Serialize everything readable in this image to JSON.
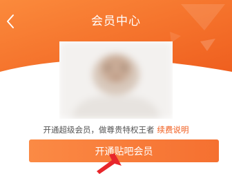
{
  "header": {
    "title": "会员中心",
    "back_icon": "chevron-left-icon"
  },
  "promo": {
    "text": "开通超级会员，做尊贵特权王者",
    "renew_link": "续费说明"
  },
  "cta": {
    "label": "开通贴吧会员"
  },
  "colors": {
    "brand_orange": "#f57a2c",
    "link_orange": "#f05a1a",
    "pointer_red": "#e8262b"
  }
}
